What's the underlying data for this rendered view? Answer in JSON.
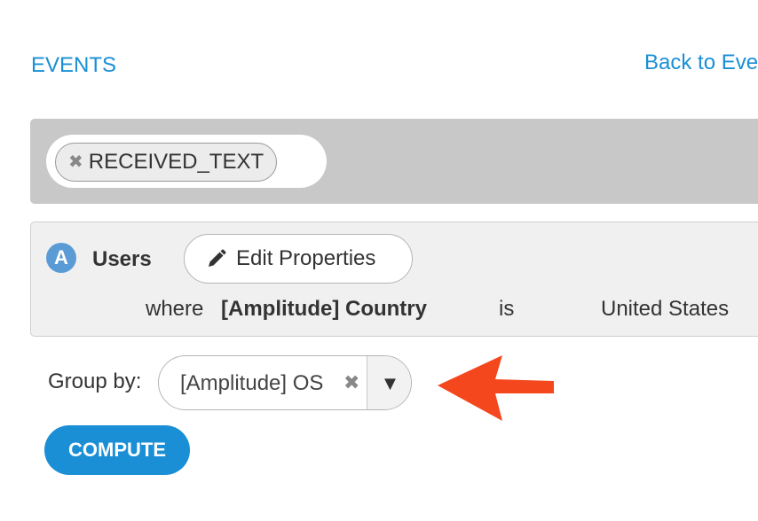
{
  "header": {
    "title": "EVENTS",
    "back_link": "Back to Eve"
  },
  "event_filter": {
    "chips": [
      {
        "remove_glyph": "✖",
        "label": "RECEIVED_TEXT"
      }
    ]
  },
  "segment": {
    "badge": "A",
    "title": "Users",
    "edit_button_label": "Edit Properties",
    "edit_icon": "pencil-icon",
    "filter": {
      "connector": "where",
      "property": "[Amplitude] Country",
      "operator": "is",
      "value": "United States"
    }
  },
  "group_by": {
    "label": "Group by:",
    "value": "[Amplitude] OS",
    "clear_glyph": "✖",
    "dropdown_glyph": "▼"
  },
  "actions": {
    "compute_label": "COMPUTE"
  },
  "annotation": {
    "icon": "arrow-left-icon",
    "color": "#f4471e"
  },
  "colors": {
    "accent": "#1a8fd6",
    "badge": "#5b9bd5",
    "event_bar": "#c8c8c8"
  }
}
